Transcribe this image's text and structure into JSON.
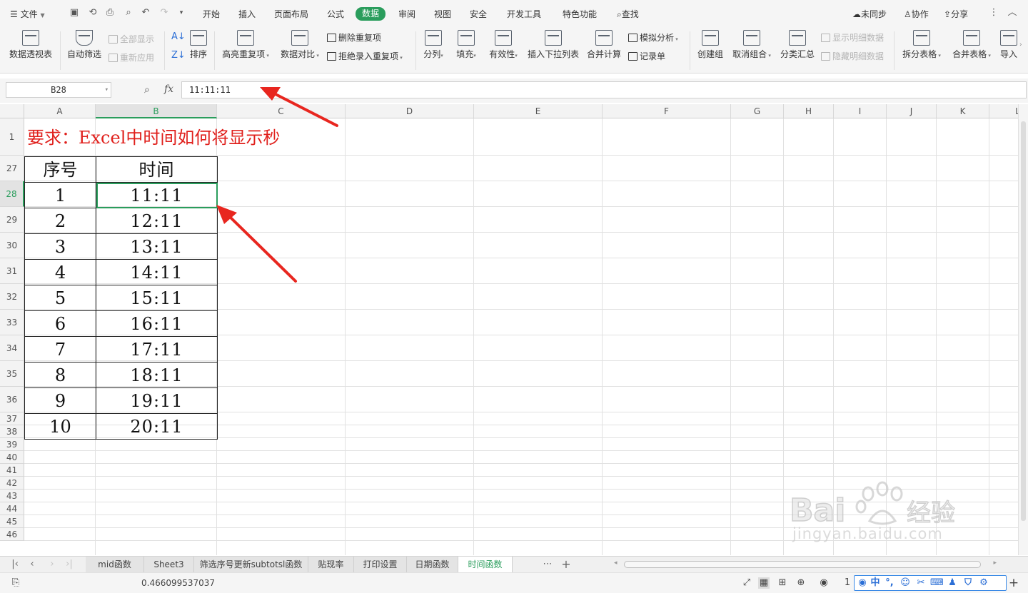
{
  "menubar": {
    "file_label": "文件",
    "tabs": [
      "开始",
      "插入",
      "页面布局",
      "公式",
      "数据",
      "审阅",
      "视图",
      "安全",
      "开发工具",
      "特色功能"
    ],
    "active_tab": "数据",
    "search_label": "查找",
    "unsynced_label": "未同步",
    "collab_label": "协作",
    "share_label": "分享"
  },
  "ribbon": {
    "pivot_table": "数据透视表",
    "auto_filter": "自动筛选",
    "show_all": "全部显示",
    "reapply": "重新应用",
    "sort": "排序",
    "highlight_dup": "高亮重复项",
    "data_compare": "数据对比",
    "remove_dup": "删除重复项",
    "reject_dup": "拒绝录入重复项",
    "split_column": "分列",
    "fill": "填充",
    "validity": "有效性",
    "insert_dropdown": "插入下拉列表",
    "merge_calc": "合并计算",
    "whatif": "模拟分析",
    "record_form": "记录单",
    "create_group": "创建组",
    "ungroup": "取消组合",
    "subtotal": "分类汇总",
    "show_detail": "显示明细数据",
    "hide_detail": "隐藏明细数据",
    "split_table": "拆分表格",
    "merge_table": "合并表格",
    "import": "导入"
  },
  "formula_bar": {
    "name_box": "B28",
    "fx_label": "fx",
    "content": "11:11:11"
  },
  "grid": {
    "columns": [
      "A",
      "B",
      "C",
      "D",
      "E",
      "F",
      "G",
      "H",
      "I",
      "J",
      "K",
      "L"
    ],
    "selected_column": "B",
    "rows": [
      "1",
      "27",
      "28",
      "29",
      "30",
      "31",
      "32",
      "33",
      "34",
      "35",
      "36",
      "37",
      "38",
      "39",
      "40",
      "41",
      "42",
      "43",
      "44",
      "45",
      "46"
    ],
    "selected_row": "28",
    "title_text": "要求：Excel中时间如何将显示秒",
    "table": {
      "headers": [
        "序号",
        "时间"
      ],
      "rows": [
        [
          "1",
          "11:11"
        ],
        [
          "2",
          "12:11"
        ],
        [
          "3",
          "13:11"
        ],
        [
          "4",
          "14:11"
        ],
        [
          "5",
          "15:11"
        ],
        [
          "6",
          "16:11"
        ],
        [
          "7",
          "17:11"
        ],
        [
          "8",
          "18:11"
        ],
        [
          "9",
          "19:11"
        ],
        [
          "10",
          "20:11"
        ]
      ]
    }
  },
  "sheet_tabs": [
    "mid函数",
    "Sheet3",
    "筛选序号更新subtotsl函数",
    "贴现率",
    "打印设置",
    "日期函数",
    "时间函数"
  ],
  "active_sheet": "时间函数",
  "status_bar": {
    "value": "0.466099537037",
    "zoom_prefix": "1"
  },
  "ime": {
    "mode": "中"
  },
  "watermark": {
    "text": "jingyan.baidu.com"
  },
  "colors": {
    "accent_green": "#2a9d5c",
    "title_red": "#e0201c",
    "arrow_red": "#e8261f"
  }
}
